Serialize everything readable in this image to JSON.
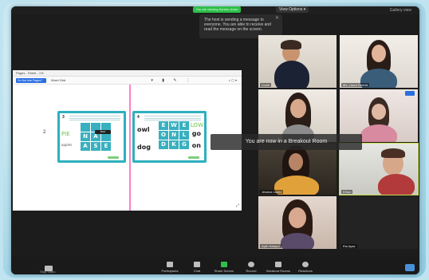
{
  "topbar": {
    "share_status": "You are viewing Screen share",
    "view_options": "View Options ▾",
    "right_label": "Gallery view"
  },
  "notification": {
    "text": "The host is sending a message to everyone. You are able to receive and read the message on the screen."
  },
  "shared_window": {
    "title": "Pages - Sheet - 1%",
    "toolbar_button": "Do Not Use Pages?",
    "toolbar_link": "Word Grid",
    "side_marker": "2",
    "card_a": {
      "number": "3",
      "letters": [
        "",
        "",
        "",
        "N",
        "A",
        "",
        "A",
        "S",
        "E"
      ],
      "left_word": "PIE",
      "left_word2": "apples",
      "tooltip": "Bold"
    },
    "card_b": {
      "number": "4",
      "letters": [
        "E",
        "W",
        "E",
        "O",
        "N",
        "L",
        "D",
        "K",
        "G"
      ],
      "right_top": "LOW",
      "words_left": [
        "owl",
        "dog"
      ],
      "words_right": [
        "go",
        "on"
      ]
    }
  },
  "breakout_message": "You are now in a Breakout Room",
  "participants": [
    {
      "name": "Lizzie"
    },
    {
      "name": "Ms. Laura Dennis"
    },
    {
      "name": ""
    },
    {
      "name": ""
    },
    {
      "name": "Jessica Lopez"
    },
    {
      "name": "Ethan"
    },
    {
      "name": "Aylin Kalayci"
    },
    {
      "name": "Ela Ayaz"
    }
  ],
  "bottombar": {
    "camera_label": "Stop Video",
    "participants_label": "Participants",
    "chat_label": "Chat",
    "share_label": "Share Screen",
    "record_label": "Record",
    "breakout_label": "Breakout Rooms",
    "reactions_label": "Reactions"
  }
}
